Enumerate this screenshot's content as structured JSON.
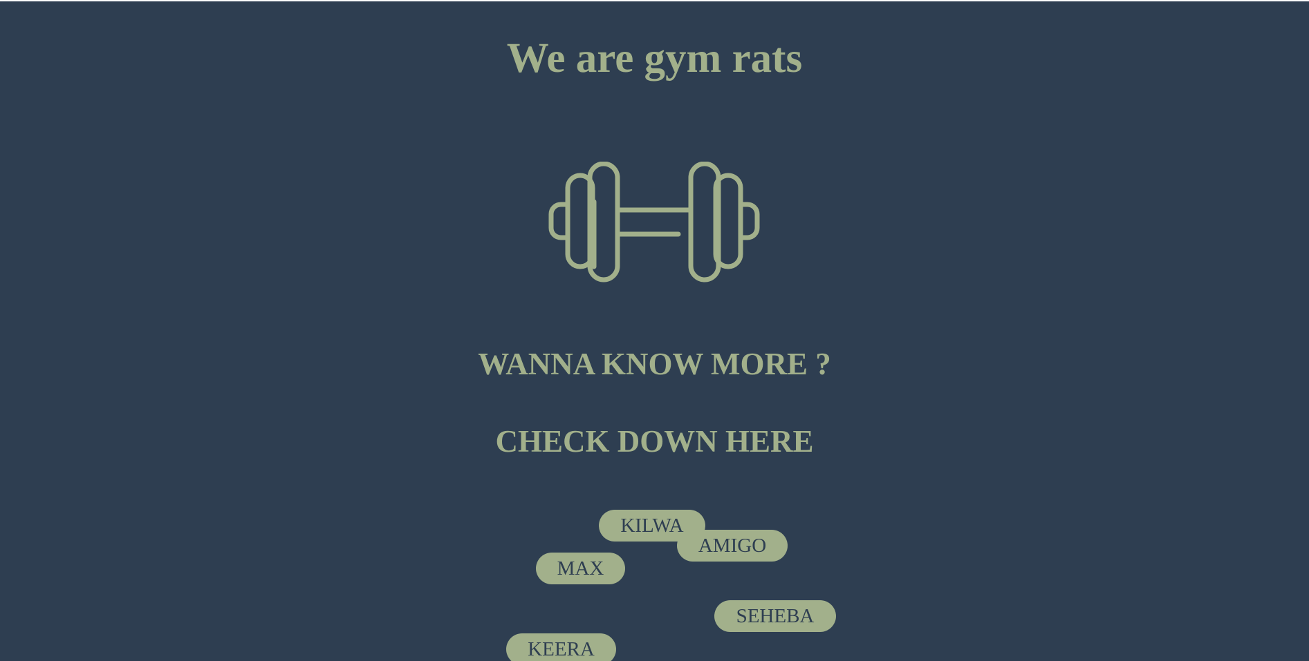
{
  "header": {
    "title": "We are gym rats"
  },
  "hero": {
    "icon": "dumbbell-icon"
  },
  "cta": {
    "line1": "WANNA KNOW MORE ?",
    "line2": "CHECK DOWN HERE"
  },
  "names": [
    {
      "label": "KILWA"
    },
    {
      "label": "AMIGO"
    },
    {
      "label": "MAX"
    },
    {
      "label": "SEHEBA"
    },
    {
      "label": "KEERA"
    }
  ],
  "colors": {
    "background": "#2e3e51",
    "accent": "#a2b08b"
  }
}
